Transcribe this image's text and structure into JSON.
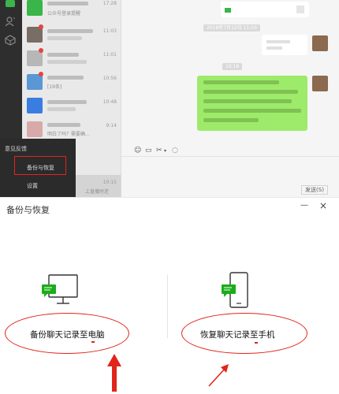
{
  "chat_window": {
    "conversations": [
      {
        "time": "17:28",
        "subtitle": "公众号登录提醒",
        "avatar_color": "#39b54a",
        "unread": false
      },
      {
        "time": "11:03",
        "subtitle": "",
        "avatar_color": "#7a6d65",
        "unread": true
      },
      {
        "time": "11:01",
        "subtitle": "",
        "avatar_color": "#b7b7b7",
        "unread": true
      },
      {
        "time": "10:56",
        "subtitle": "[19条]",
        "avatar_color": "#5a97d4",
        "unread": true
      },
      {
        "time": "10:48",
        "subtitle": "",
        "avatar_color": "#3a7de0",
        "unread": false
      },
      {
        "time": "9:14",
        "subtitle": "明白了吗？需要确...",
        "avatar_color": "#d8a9a9",
        "unread": false
      },
      {
        "time": "",
        "subtitle": "",
        "avatar_color": "#c9c9c9",
        "unread": false
      },
      {
        "time": "10:15",
        "subtitle": "上直播时还",
        "avatar_color": "#a0a0a0",
        "unread": false
      }
    ],
    "menu": {
      "feedback": "意见反馈",
      "backup_restore": "备份与恢复",
      "settings": "设置"
    },
    "timestamps": [
      "2018年7月12日 11:03",
      "10:16"
    ],
    "send_label": "发送(S)",
    "colors": {
      "sidebar": "#2e2e2e",
      "bubble_green": "#9eea6a",
      "highlight": "#e1251b"
    }
  },
  "dialog": {
    "title": "备份与恢复",
    "minimize_symbol": "—",
    "close_symbol": "×",
    "options": {
      "backup_to_pc": "备份聊天记录至电脑",
      "restore_to_phone": "恢复聊天记录至手机"
    },
    "accent_color": "#1aad19",
    "annotation_color": "#e1251b"
  }
}
